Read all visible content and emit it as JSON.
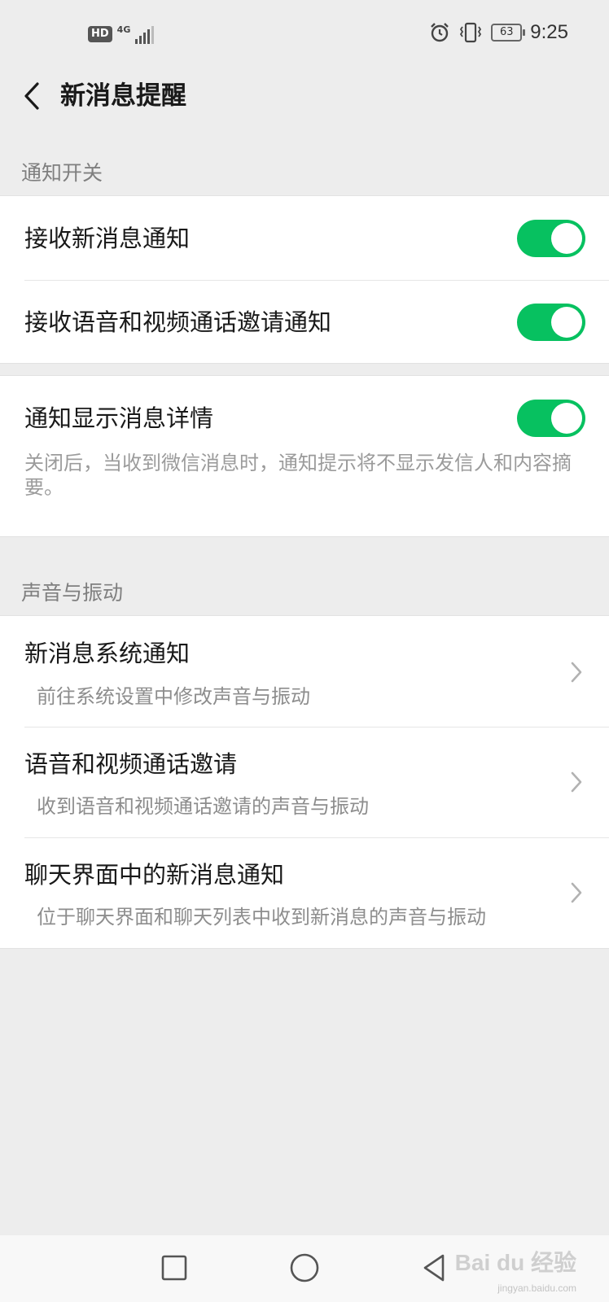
{
  "status_bar": {
    "hd": "HD",
    "network": "4G",
    "battery": "63",
    "time": "9:25"
  },
  "header": {
    "title": "新消息提醒",
    "back_icon": "chevron-left-icon"
  },
  "sections": [
    {
      "title": "通知开关"
    },
    {
      "title": "声音与振动"
    }
  ],
  "notification_switches": {
    "items": [
      {
        "label": "接收新消息通知",
        "enabled": true
      },
      {
        "label": "接收语音和视频通话邀请通知",
        "enabled": true
      }
    ]
  },
  "detail_switch": {
    "label": "通知显示消息详情",
    "enabled": true,
    "description": "关闭后，当收到微信消息时，通知提示将不显示发信人和内容摘要。"
  },
  "sound_items": [
    {
      "label": "新消息系统通知",
      "sub": "前往系统设置中修改声音与振动"
    },
    {
      "label": "语音和视频通话邀请",
      "sub": "收到语音和视频通话邀请的声音与振动"
    },
    {
      "label": "聊天界面中的新消息通知",
      "sub": "位于聊天界面和聊天列表中收到新消息的声音与振动"
    }
  ],
  "colors": {
    "accent": "#07C160",
    "background": "#EDEDED",
    "card": "#FFFFFF"
  },
  "watermark": {
    "text": "Bai du 经验",
    "sub": "jingyan.baidu.com"
  }
}
